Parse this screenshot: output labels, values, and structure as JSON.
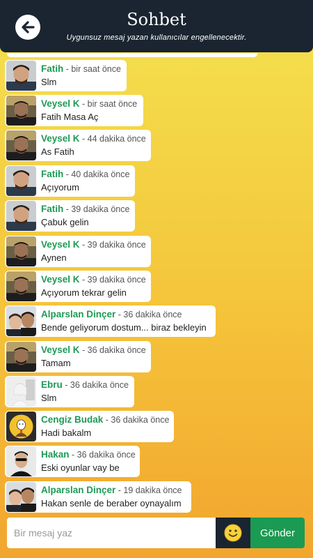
{
  "header": {
    "title": "Sohbet",
    "subtitle": "Uygunsuz mesaj yazan kullanıcılar engellenecektir."
  },
  "messages": [
    {
      "user": "Fatih",
      "time": "bir saat önce",
      "text": "Slm",
      "avatar": "fatih"
    },
    {
      "user": "Veysel K",
      "time": "bir saat önce",
      "text": "Fatih Masa Aç",
      "avatar": "veysel"
    },
    {
      "user": "Veysel K",
      "time": "44 dakika önce",
      "text": "As Fatih",
      "avatar": "veysel"
    },
    {
      "user": "Fatih",
      "time": "40 dakika önce",
      "text": "Açıyorum",
      "avatar": "fatih"
    },
    {
      "user": "Fatih",
      "time": "39 dakika önce",
      "text": "Çabuk gelin",
      "avatar": "fatih"
    },
    {
      "user": "Veysel K",
      "time": "39 dakika önce",
      "text": "Aynen",
      "avatar": "veysel"
    },
    {
      "user": "Veysel K",
      "time": "39 dakika önce",
      "text": "Açıyorum tekrar gelin",
      "avatar": "veysel"
    },
    {
      "user": "Alparslan Dinçer",
      "time": "36 dakika önce",
      "text": "Bende geliyorum dostum... biraz bekleyin",
      "avatar": "alparslan"
    },
    {
      "user": "Veysel K",
      "time": "36 dakika önce",
      "text": "Tamam",
      "avatar": "veysel"
    },
    {
      "user": "Ebru",
      "time": "36 dakika önce",
      "text": "Slm",
      "avatar": "ebru"
    },
    {
      "user": "Cengiz Budak",
      "time": "36 dakika önce",
      "text": "Hadi bakalm",
      "avatar": "cengiz"
    },
    {
      "user": "Hakan",
      "time": "36 dakika önce",
      "text": "Eski oyunlar vay be",
      "avatar": "hakan"
    },
    {
      "user": "Alparslan Dinçer",
      "time": "19 dakika önce",
      "text": "Hakan senle de beraber oynayalım",
      "avatar": "alparslan"
    }
  ],
  "composer": {
    "placeholder": "Bir mesaj yaz",
    "send_label": "Gönder"
  }
}
